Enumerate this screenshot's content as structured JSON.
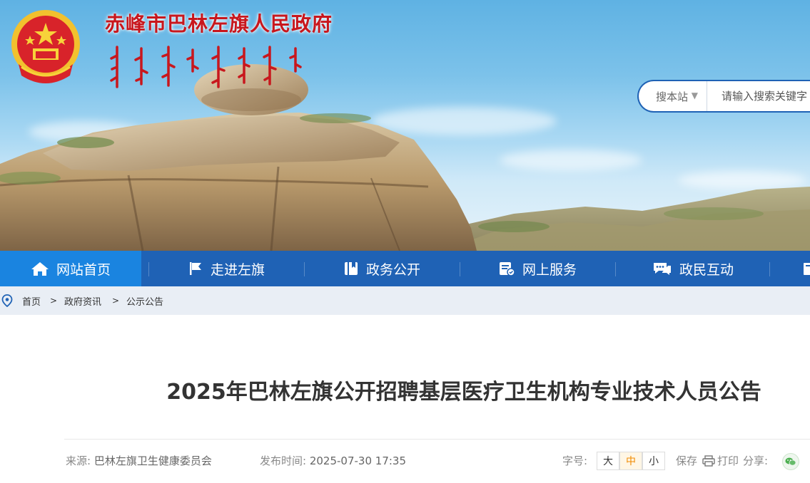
{
  "header": {
    "site_title": "赤峰市巴林左旗人民政府",
    "emblem_icon": "national-emblem-icon",
    "mongolian_title_icon": "mongolian-script-title"
  },
  "search": {
    "scope_label": "搜本站",
    "placeholder": "请输入搜索关键字"
  },
  "nav": {
    "items": [
      {
        "label": "网站首页",
        "icon": "home-icon",
        "active": true
      },
      {
        "label": "走进左旗",
        "icon": "flag-icon"
      },
      {
        "label": "政务公开",
        "icon": "book-icon"
      },
      {
        "label": "网上服务",
        "icon": "service-card-icon"
      },
      {
        "label": "政民互动",
        "icon": "chat-icon"
      }
    ],
    "colors": {
      "bar": "#1f62b5",
      "active": "#1a84e0"
    }
  },
  "breadcrumb": {
    "items": [
      "首页",
      "政府资讯",
      "公示公告"
    ],
    "separator": ">"
  },
  "article": {
    "title": "2025年巴林左旗公开招聘基层医疗卫生机构专业技术人员公告",
    "source_label": "来源:",
    "source": "巴林左旗卫生健康委员会",
    "date_label": "发布时间:",
    "date": "2025-07-30 17:35",
    "font_size_label": "字号:",
    "font_sizes": [
      "大",
      "中",
      "小"
    ],
    "font_size_selected": "中",
    "save_label": "保存",
    "print_label": "打印",
    "share_label": "分享:"
  }
}
